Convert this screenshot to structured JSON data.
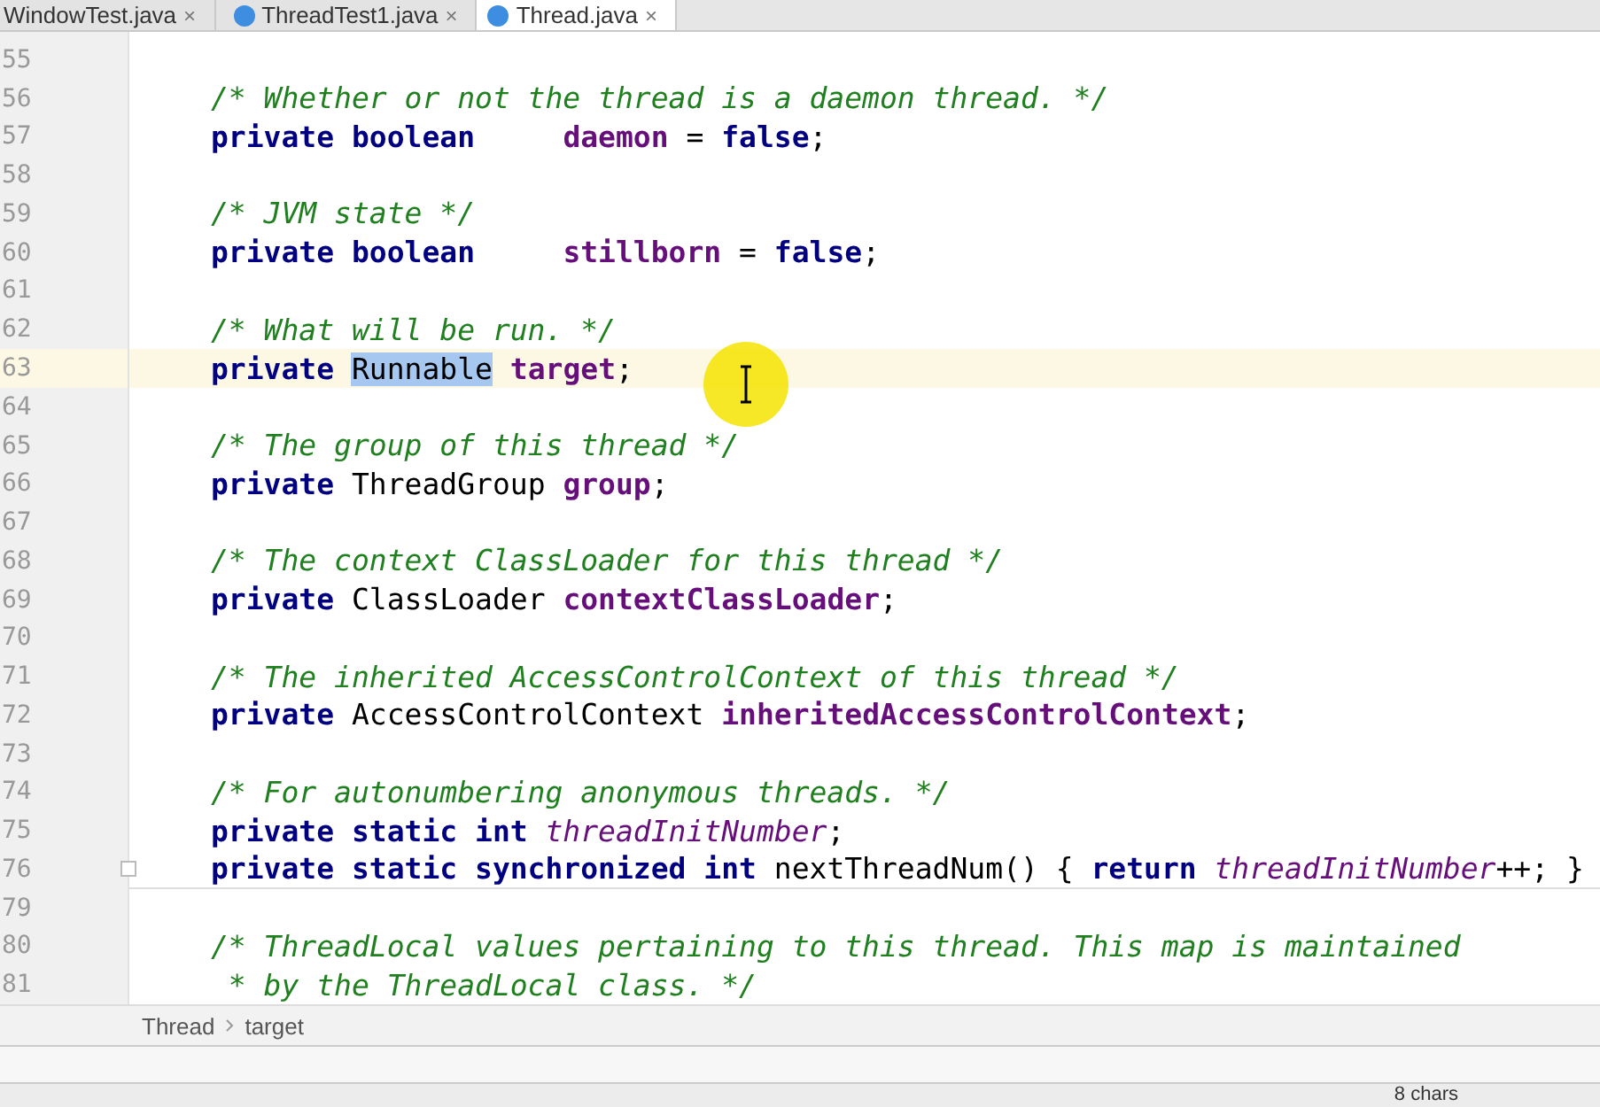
{
  "tabs": [
    {
      "label": "WindowTest.java",
      "selected": false,
      "icon": false,
      "close": "×"
    },
    {
      "label": "ThreadTest1.java",
      "selected": false,
      "icon": true,
      "close": "×"
    },
    {
      "label": "Thread.java",
      "selected": true,
      "icon": true,
      "close": "×"
    }
  ],
  "lines": [
    {
      "number": "55",
      "current": false,
      "fold": false
    },
    {
      "number": "56",
      "current": false,
      "fold": false,
      "tokens": [
        {
          "kind": "comment",
          "text": "/* Whether or not the thread is a daemon thread. */"
        }
      ]
    },
    {
      "number": "57",
      "current": false,
      "fold": false,
      "tokens": [
        {
          "kind": "keyword",
          "text": "private boolean     "
        },
        {
          "kind": "field",
          "text": "daemon"
        },
        {
          "kind": "plain",
          "text": " = "
        },
        {
          "kind": "keyword",
          "text": "false"
        },
        {
          "kind": "plain",
          "text": ";"
        }
      ]
    },
    {
      "number": "58",
      "current": false,
      "fold": false
    },
    {
      "number": "59",
      "current": false,
      "fold": false,
      "tokens": [
        {
          "kind": "comment",
          "text": "/* JVM state */"
        }
      ]
    },
    {
      "number": "60",
      "current": false,
      "fold": false,
      "tokens": [
        {
          "kind": "keyword",
          "text": "private boolean     "
        },
        {
          "kind": "field",
          "text": "stillborn"
        },
        {
          "kind": "plain",
          "text": " = "
        },
        {
          "kind": "keyword",
          "text": "false"
        },
        {
          "kind": "plain",
          "text": ";"
        }
      ]
    },
    {
      "number": "61",
      "current": false,
      "fold": false
    },
    {
      "number": "62",
      "current": false,
      "fold": false,
      "tokens": [
        {
          "kind": "comment",
          "text": "/* What will be run. */"
        }
      ]
    },
    {
      "number": "63",
      "current": true,
      "fold": false,
      "tokens": [
        {
          "kind": "keyword",
          "text": "private "
        },
        {
          "kind": "selected",
          "text": "Runnable"
        },
        {
          "kind": "field",
          "text": " target"
        },
        {
          "kind": "plain",
          "text": ";"
        }
      ]
    },
    {
      "number": "64",
      "current": false,
      "fold": false
    },
    {
      "number": "65",
      "current": false,
      "fold": false,
      "tokens": [
        {
          "kind": "comment",
          "text": "/* The group of this thread */"
        }
      ]
    },
    {
      "number": "66",
      "current": false,
      "fold": false,
      "tokens": [
        {
          "kind": "keyword",
          "text": "private"
        },
        {
          "kind": "plain",
          "text": " ThreadGroup "
        },
        {
          "kind": "field",
          "text": "group"
        },
        {
          "kind": "plain",
          "text": ";"
        }
      ]
    },
    {
      "number": "67",
      "current": false,
      "fold": false
    },
    {
      "number": "68",
      "current": false,
      "fold": false,
      "tokens": [
        {
          "kind": "comment",
          "text": "/* The context ClassLoader for this thread */"
        }
      ]
    },
    {
      "number": "69",
      "current": false,
      "fold": false,
      "tokens": [
        {
          "kind": "keyword",
          "text": "private"
        },
        {
          "kind": "plain",
          "text": " ClassLoader "
        },
        {
          "kind": "field",
          "text": "contextClassLoader"
        },
        {
          "kind": "plain",
          "text": ";"
        }
      ]
    },
    {
      "number": "70",
      "current": false,
      "fold": false
    },
    {
      "number": "71",
      "current": false,
      "fold": false,
      "tokens": [
        {
          "kind": "comment",
          "text": "/* The inherited AccessControlContext of this thread */"
        }
      ]
    },
    {
      "number": "72",
      "current": false,
      "fold": false,
      "tokens": [
        {
          "kind": "keyword",
          "text": "private"
        },
        {
          "kind": "plain",
          "text": " AccessControlContext "
        },
        {
          "kind": "field",
          "text": "inheritedAccessControlContext"
        },
        {
          "kind": "plain",
          "text": ";"
        }
      ]
    },
    {
      "number": "73",
      "current": false,
      "fold": false
    },
    {
      "number": "74",
      "current": false,
      "fold": false,
      "tokens": [
        {
          "kind": "comment",
          "text": "/* For autonumbering anonymous threads. */"
        }
      ]
    },
    {
      "number": "75",
      "current": false,
      "fold": false,
      "tokens": [
        {
          "kind": "keyword",
          "text": "private static int "
        },
        {
          "kind": "static",
          "text": "threadInitNumber"
        },
        {
          "kind": "plain",
          "text": ";"
        }
      ]
    },
    {
      "number": "76",
      "current": false,
      "fold": true,
      "tokens": [
        {
          "kind": "keyword",
          "text": "private static synchronized int"
        },
        {
          "kind": "plain",
          "text": " nextThreadNum() { "
        },
        {
          "kind": "keyword",
          "text": "return "
        },
        {
          "kind": "static",
          "text": "threadInitNumber"
        },
        {
          "kind": "plain",
          "text": "++; }"
        }
      ]
    },
    {
      "number": "79",
      "current": false,
      "fold": false
    },
    {
      "number": "80",
      "current": false,
      "fold": false,
      "tokens": [
        {
          "kind": "comment",
          "text": "/* ThreadLocal values pertaining to this thread. This map is maintained"
        }
      ]
    },
    {
      "number": "81",
      "current": false,
      "fold": false,
      "tokens": [
        {
          "kind": "comment",
          "text": " * by the ThreadLocal class. */"
        }
      ]
    }
  ],
  "breadcrumbs": [
    "Thread",
    "target"
  ],
  "status": {
    "text": "8 chars"
  }
}
